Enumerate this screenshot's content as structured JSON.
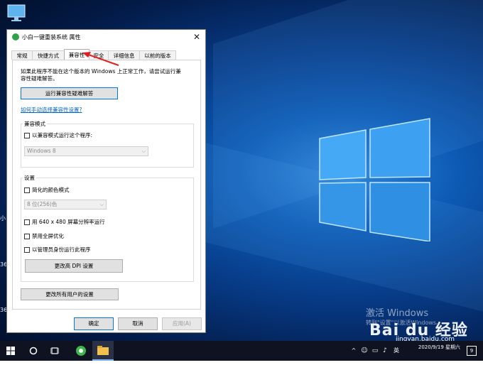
{
  "desktop": {
    "edge_labels": [
      "小",
      "36",
      "36"
    ],
    "watermark_title": "激活 Windows",
    "watermark_sub": "转到\"设置\"以激活Windows。",
    "baidu_logo": "Bai du 经验",
    "baidu_url": "jingyan.baidu.com"
  },
  "dialog": {
    "title": "小白一键重装系统 属性",
    "close_label": "✕",
    "tabs": [
      "常规",
      "快捷方式",
      "兼容性",
      "安全",
      "详细信息",
      "以前的版本"
    ],
    "active_tab": "兼容性",
    "intro": [
      "如果此程序不能在这个版本的 Windows 上正常工作，请尝试运行兼",
      "容性疑难解答。"
    ],
    "troubleshoot_button": "运行兼容性疑难解答",
    "manual_link": "如何手动选择兼容性设置?",
    "compat_mode": {
      "group_label": "兼容模式",
      "checkbox_label": "以兼容模式运行这个程序:",
      "select_value": "Windows 8"
    },
    "settings": {
      "group_label": "设置",
      "reduced_color_label": "简化的颜色模式",
      "color_select_value": "8 位(256)色",
      "run_640_label": "用 640 x 480 屏幕分辨率运行",
      "disable_fullscreen_label": "禁用全屏优化",
      "run_admin_label": "以管理员身份运行此程序",
      "dpi_button": "更改高 DPI 设置"
    },
    "all_users_button": "更改所有用户的设置",
    "ok_button": "确定",
    "cancel_button": "取消",
    "apply_button": "应用(A)"
  },
  "taskbar": {
    "start_icon": "windows-start-icon",
    "search_icon": "cortana-circle-icon",
    "taskview_icon": "task-view-icon",
    "tray_lang": "英",
    "clock_time": "",
    "clock_date": "2020/9/19 星期六",
    "notification_count": "9"
  },
  "colors": {
    "accent": "#0078d7",
    "arrow": "#e02020",
    "link": "#0066cc"
  }
}
